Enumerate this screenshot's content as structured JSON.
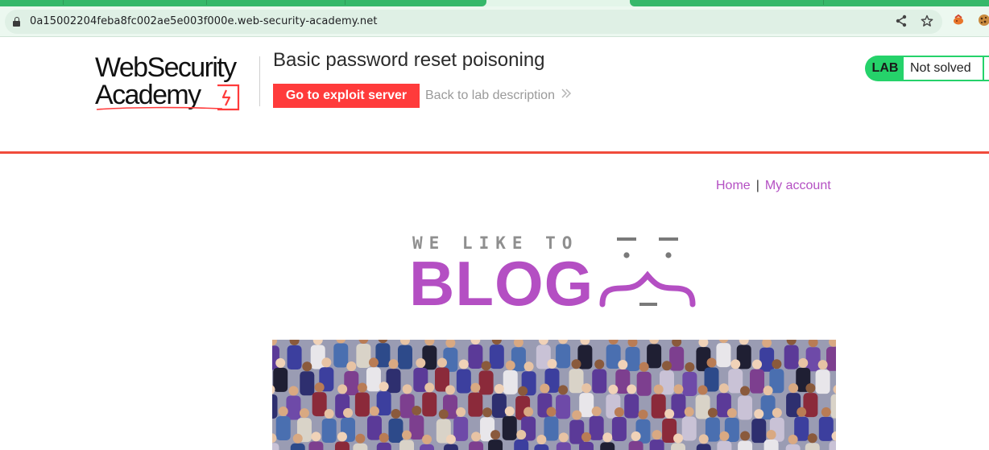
{
  "browser": {
    "url": "0a15002204feba8fc002ae5e003f000e.web-security-academy.net"
  },
  "lab": {
    "logo_line1": "WebSecurity",
    "logo_line2": "Academy",
    "title": "Basic password reset poisoning",
    "exploit_button": "Go to exploit server",
    "back_link": "Back to lab description",
    "status_badge": "LAB",
    "status_text": "Not solved"
  },
  "blog": {
    "nav": {
      "home": "Home",
      "separator": "|",
      "my_account": "My account"
    },
    "banner_top": "WE LIKE TO",
    "banner_main": "BLOG"
  },
  "colors": {
    "accent_red": "#ff3b3b",
    "header_rule": "#f04b3b",
    "blog_purple": "#b44fc3",
    "lab_green": "#25d26a",
    "browser_green": "#36b86a"
  },
  "icons": [
    "lock-icon",
    "share-icon",
    "star-icon",
    "extension-icon",
    "cookie-icon",
    "chevron-right-icon"
  ]
}
